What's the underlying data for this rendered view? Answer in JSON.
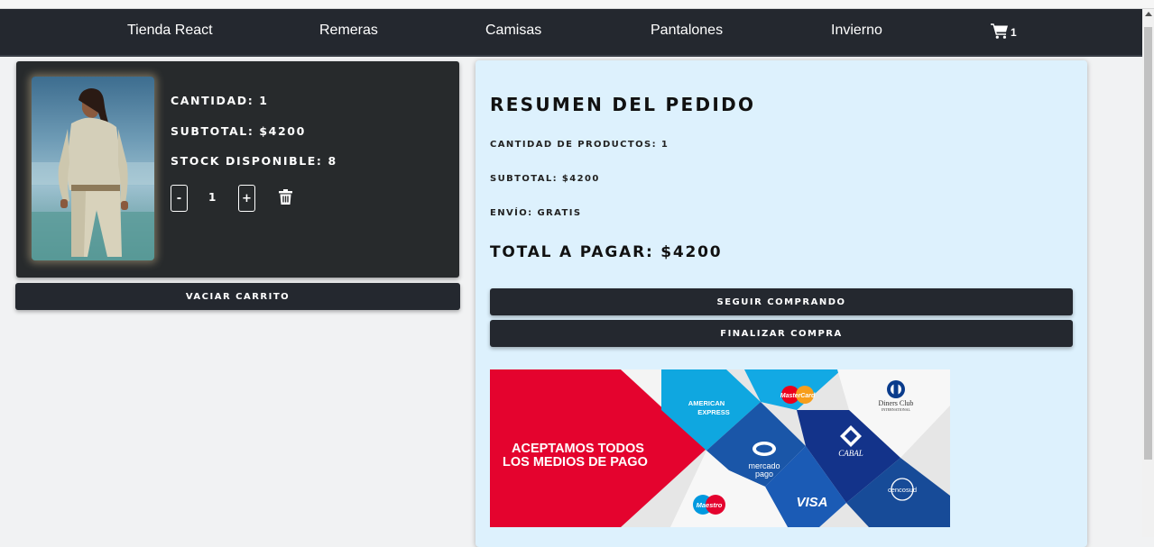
{
  "nav": {
    "brand": "Tienda React",
    "links": [
      "Remeras",
      "Camisas",
      "Pantalones",
      "Invierno"
    ],
    "cart_count": "1"
  },
  "cart_item": {
    "quantity_label": "CANTIDAD: 1",
    "subtotal_label": "SUBTOTAL: $4200",
    "stock_label": "STOCK DISPONIBLE: 8",
    "decrement": "-",
    "qty": "1",
    "increment": "+"
  },
  "empty_cart": "VACIAR CARRITO",
  "summary": {
    "title": "RESUMEN DEL PEDIDO",
    "product_count": "CANTIDAD DE PRODUCTOS: 1",
    "subtotal": "SUBTOTAL: $4200",
    "shipping": "ENVÍO: GRATIS",
    "total": "TOTAL A PAGAR: $4200",
    "continue_button": "SEGUIR COMPRANDO",
    "checkout_button": "FINALIZAR COMPRA"
  },
  "payment_banner": {
    "headline_1": "ACEPTAMOS TODOS",
    "headline_2": "LOS MEDIOS DE PAGO",
    "amex_1": "AMERICAN",
    "amex_2": "EXPRESS",
    "mastercard": "MasterCard",
    "diners_1": "Diners Club",
    "diners_2": "INTERNATIONAL",
    "mercadopago_1": "mercado",
    "mercadopago_2": "pago",
    "cabal": "CABAL",
    "visa": "VISA",
    "cencosud": "cencosud",
    "maestro": "Maestro"
  },
  "colors": {
    "navbar": "#24282f",
    "card": "#272a2c",
    "summary_bg": "#ddf1fd",
    "banner_red": "#e4032e",
    "amex_blue": "#0fa7e0",
    "visa_blue": "#1a56a8",
    "cabal_navy": "#13338a"
  }
}
